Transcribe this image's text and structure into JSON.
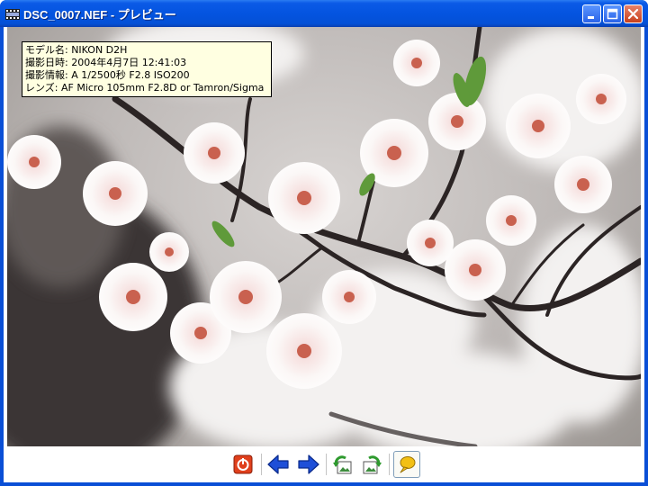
{
  "window": {
    "title": "DSC_0007.NEF - プレビュー",
    "app_icon": "film-icon"
  },
  "titlebar_buttons": [
    {
      "name": "minimize-button",
      "icon": "minimize-icon"
    },
    {
      "name": "maximize-button",
      "icon": "maximize-icon"
    },
    {
      "name": "close-button",
      "icon": "close-icon"
    }
  ],
  "info_panel": {
    "model": "モデル名: NIKON D2H",
    "date": "撮影日時: 2004年4月7日 12:41:03",
    "exposure": "撮影情報: A 1/2500秒 F2.8 ISO200",
    "lens": "レンズ: AF Micro 105mm F2.8D or Tamron/Sigma"
  },
  "toolbar": [
    {
      "name": "stop-button",
      "icon": "stop-icon"
    },
    {
      "name": "previous-button",
      "icon": "arrow-left-icon"
    },
    {
      "name": "next-button",
      "icon": "arrow-right-icon"
    },
    {
      "name": "rotate-left-button",
      "icon": "rotate-left-icon"
    },
    {
      "name": "rotate-right-button",
      "icon": "rotate-right-icon"
    },
    {
      "name": "info-toggle-button",
      "icon": "speech-balloon-icon",
      "pressed": true
    }
  ],
  "colors": {
    "titlebar": "#0454e0",
    "info_background": "#ffffe1",
    "arrow_blue": "#1e4fd8",
    "rotate_green": "#2e9a2e",
    "stop_red": "#e0401c",
    "balloon_yellow": "#f2c014"
  }
}
